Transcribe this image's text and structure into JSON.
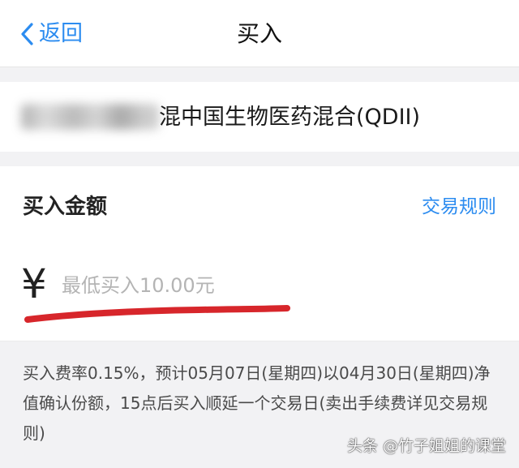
{
  "nav": {
    "back_label": "返回",
    "title": "买入",
    "back_icon": "chevron-left-icon"
  },
  "fund": {
    "name_visible": "混中国生物医药混合(QDII)"
  },
  "amount": {
    "title": "买入金额",
    "rules_link": "交易规则",
    "currency_symbol": "¥",
    "placeholder": "最低买入10.00元"
  },
  "note": {
    "text": "买入费率0.15%，预计05月07日(星期四)以04月30日(星期四)净值确认份额，15点后买入顺延一个交易日(卖出手续费详见交易规则)"
  },
  "watermark": {
    "text": "头条 @竹子姐姐的课堂"
  },
  "colors": {
    "accent": "#2c8cf0",
    "background": "#f2f2f4",
    "annotation_red": "#d7262b"
  }
}
